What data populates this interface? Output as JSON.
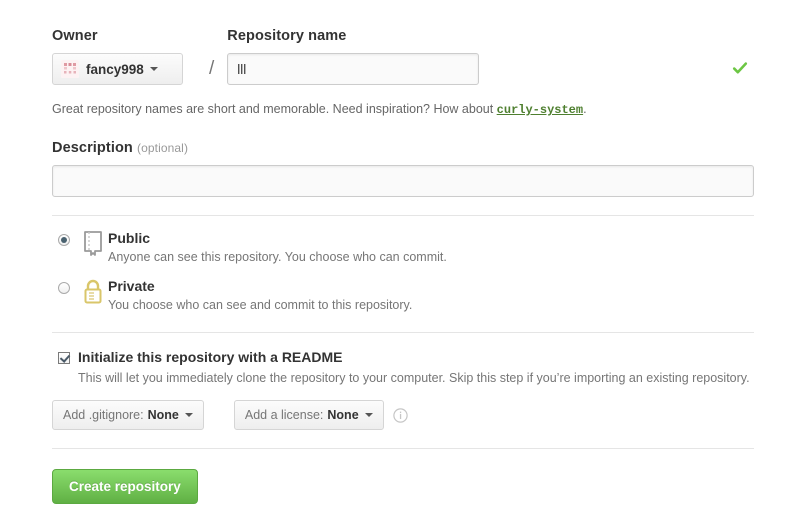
{
  "owner": {
    "label": "Owner",
    "name": "fancy998",
    "avatar_icon": "identicon-avatar",
    "caret_icon": "chevron-down-icon"
  },
  "separator": "/",
  "repository": {
    "label": "Repository name",
    "value": "lll",
    "placeholder": "",
    "valid_icon": "check-icon"
  },
  "hint": {
    "text": "Great repository names are short and memorable. Need inspiration? How about ",
    "suggestion": "curly-system",
    "period": "."
  },
  "description": {
    "label": "Description",
    "optional": "(optional)",
    "value": "",
    "placeholder": ""
  },
  "visibility": {
    "options": [
      {
        "id": "public",
        "title": "Public",
        "description": "Anyone can see this repository. You choose who can commit.",
        "icon": "repo-book-icon",
        "selected": true
      },
      {
        "id": "private",
        "title": "Private",
        "description": "You choose who can see and commit to this repository.",
        "icon": "lock-icon",
        "selected": false
      }
    ]
  },
  "readme": {
    "title": "Initialize this repository with a README",
    "description": "This will let you immediately clone the repository to your computer. Skip this step if you’re importing an existing repository.",
    "checked": true
  },
  "gitignore": {
    "label": "Add .gitignore:",
    "value": "None",
    "caret_icon": "chevron-down-icon"
  },
  "license": {
    "label": "Add a license:",
    "value": "None",
    "caret_icon": "chevron-down-icon",
    "info_icon": "info-circle-icon"
  },
  "submit": {
    "label": "Create repository"
  },
  "colors": {
    "accent_green": "#60b044",
    "suggestion_green": "#4e7f2f",
    "valid_check": "#6cc644",
    "lock_yellow": "#d9c66a",
    "repo_icon_gray": "#9a9a9a",
    "muted_text": "#767676",
    "border": "#cccccc"
  }
}
